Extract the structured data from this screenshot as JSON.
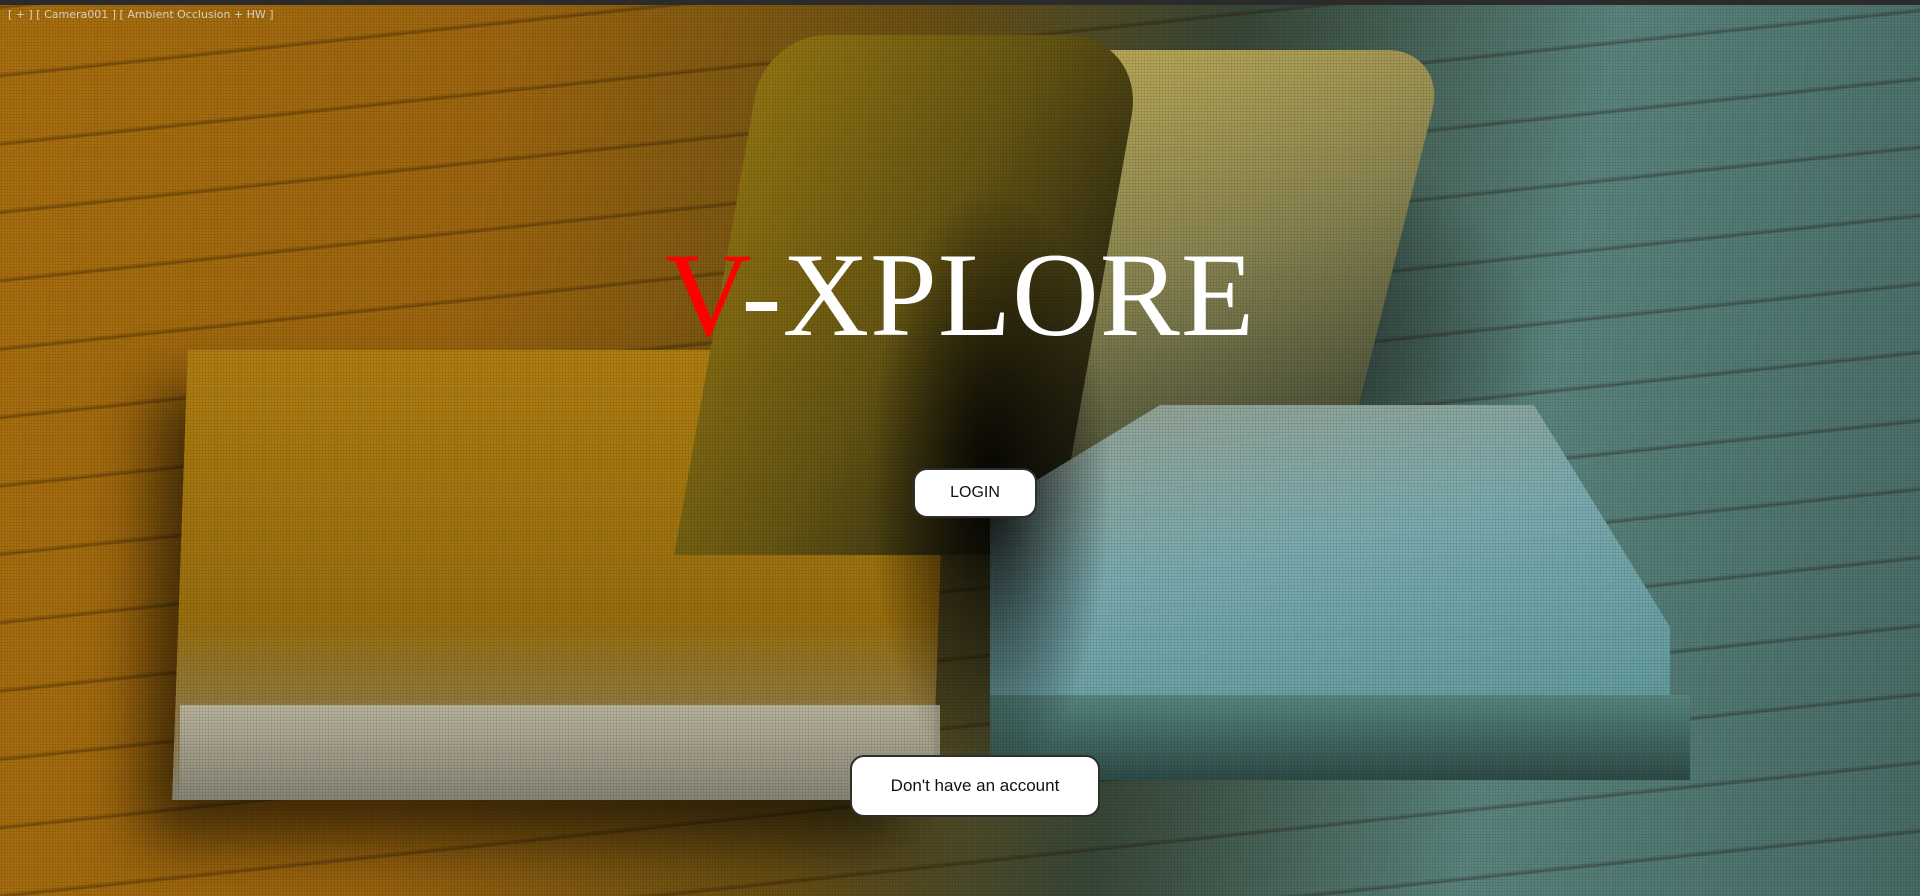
{
  "viewport_caption": "[ + ] [ Camera001 ] [ Ambient Occlusion + HW ]",
  "brand": {
    "title_accent": "V",
    "title_rest": "-XPLORE",
    "accent_color": "#ff0000",
    "text_color": "#ffffff"
  },
  "actions": {
    "login_label": "LOGIN",
    "signup_label": "Don't have an account"
  },
  "background": {
    "description_icon": "open-book-on-wood-image"
  }
}
